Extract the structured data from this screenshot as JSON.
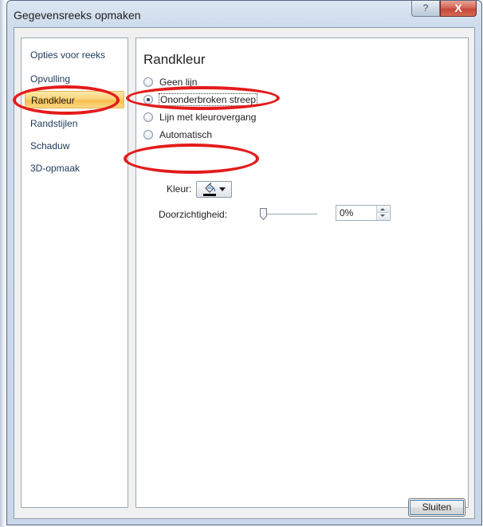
{
  "window": {
    "title": "Gegevensreeks opmaken",
    "help_glyph": "?",
    "close_glyph": "X"
  },
  "nav": {
    "items": [
      {
        "label": "Opties voor reeks",
        "selected": false
      },
      {
        "label": "Opvulling",
        "selected": false
      },
      {
        "label": "Randkleur",
        "selected": true
      },
      {
        "label": "Randstijlen",
        "selected": false
      },
      {
        "label": "Schaduw",
        "selected": false
      },
      {
        "label": "3D-opmaak",
        "selected": false
      }
    ]
  },
  "content": {
    "heading": "Randkleur",
    "options": [
      {
        "label": "Geen lijn",
        "checked": false
      },
      {
        "label": "Ononderbroken streep",
        "checked": true
      },
      {
        "label": "Lijn met kleurovergang",
        "checked": false
      },
      {
        "label": "Automatisch",
        "checked": false
      }
    ],
    "color_label": "Kleur:",
    "color_value": "#000000",
    "transparency_label": "Doorzichtigheid:",
    "transparency_value": "0%",
    "transparency_fraction": 0
  },
  "footer": {
    "close_button": "Sluiten"
  },
  "colors": {
    "annotation": "#e41b1b",
    "selection": "#fbd57c"
  }
}
